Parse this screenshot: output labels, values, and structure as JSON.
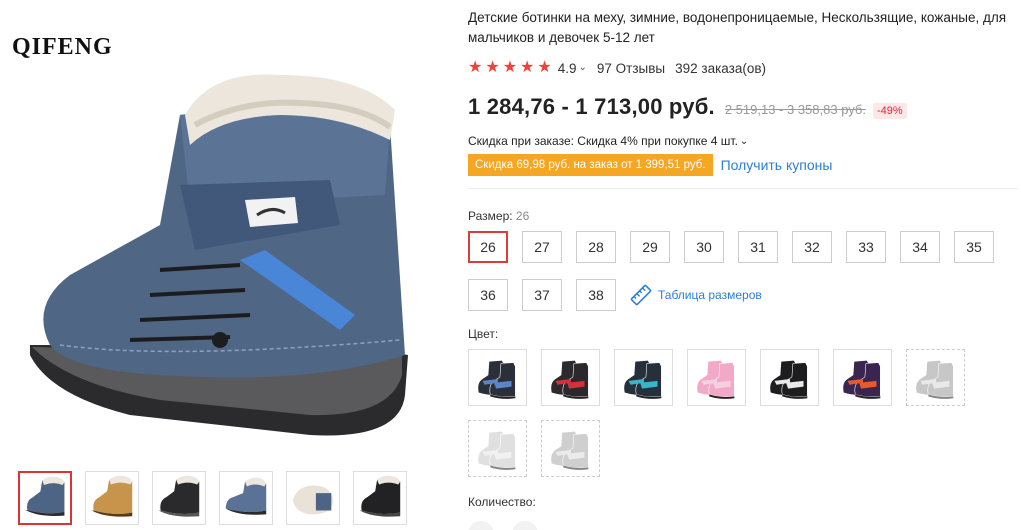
{
  "brand": "QIFENG",
  "product": {
    "title": "Детские ботинки на меху, зимние, водонепроницаемые, Нескользящие, кожаные, для мальчиков и девочек 5-12 лет",
    "rating": "4.9",
    "reviews": "97 Отзывы",
    "orders": "392 заказа(ов)",
    "price": "1 284,76 - 1 713,00 руб.",
    "old_price": "2 519,13 - 3 358,83 руб.",
    "discount": "-49%",
    "promo": "Скидка при заказе: Скидка 4% при покупке 4 шт.",
    "coupon_badge": "Скидка 69,98 руб. на заказ от 1 399,51 руб.",
    "coupon_link": "Получить купоны"
  },
  "size": {
    "label": "Размер:",
    "selected": "26",
    "options": [
      "26",
      "27",
      "28",
      "29",
      "30",
      "31",
      "32",
      "33",
      "34",
      "35",
      "36",
      "37",
      "38"
    ],
    "chart_link": "Таблица размеров"
  },
  "color": {
    "label": "Цвет:",
    "options": [
      {
        "name": "black-blue-camo",
        "base": "#2a2f3a",
        "accent": "#5a86c8",
        "available": true
      },
      {
        "name": "black-red-camo",
        "base": "#2a2a2e",
        "accent": "#d2323a",
        "available": true
      },
      {
        "name": "black-cyan-camo",
        "base": "#25303a",
        "accent": "#3ab4c8",
        "available": true
      },
      {
        "name": "pink",
        "base": "#f2a9c8",
        "accent": "#f7d0e0",
        "available": true
      },
      {
        "name": "black",
        "base": "#1d1d1f",
        "accent": "#e8e8e8",
        "available": true
      },
      {
        "name": "purple",
        "base": "#3a2450",
        "accent": "#e85a2a",
        "available": true
      },
      {
        "name": "grey",
        "base": "#9a9a9a",
        "accent": "#d8d8d8",
        "available": false
      },
      {
        "name": "light-grey",
        "base": "#c8c8c8",
        "accent": "#e6e6e6",
        "available": false
      },
      {
        "name": "grey-2",
        "base": "#a8a8a8",
        "accent": "#dcdcdc",
        "available": false
      }
    ]
  },
  "gallery": {
    "thumbs": [
      {
        "name": "blue-boot",
        "base": "#4e6484"
      },
      {
        "name": "tan-boot",
        "base": "#c8934a"
      },
      {
        "name": "black-boot",
        "base": "#2a2a2c"
      },
      {
        "name": "blue-boot-side",
        "base": "#5a7296"
      },
      {
        "name": "fur-lining",
        "base": "#e9e2d6"
      },
      {
        "name": "black-boot-2",
        "base": "#222224"
      }
    ]
  },
  "quantity": {
    "label": "Количество:"
  },
  "colors": {
    "star": "#f0413c",
    "accent_red": "#e0393a",
    "link_blue": "#2b7fd6",
    "coupon_orange": "#f5a623"
  }
}
